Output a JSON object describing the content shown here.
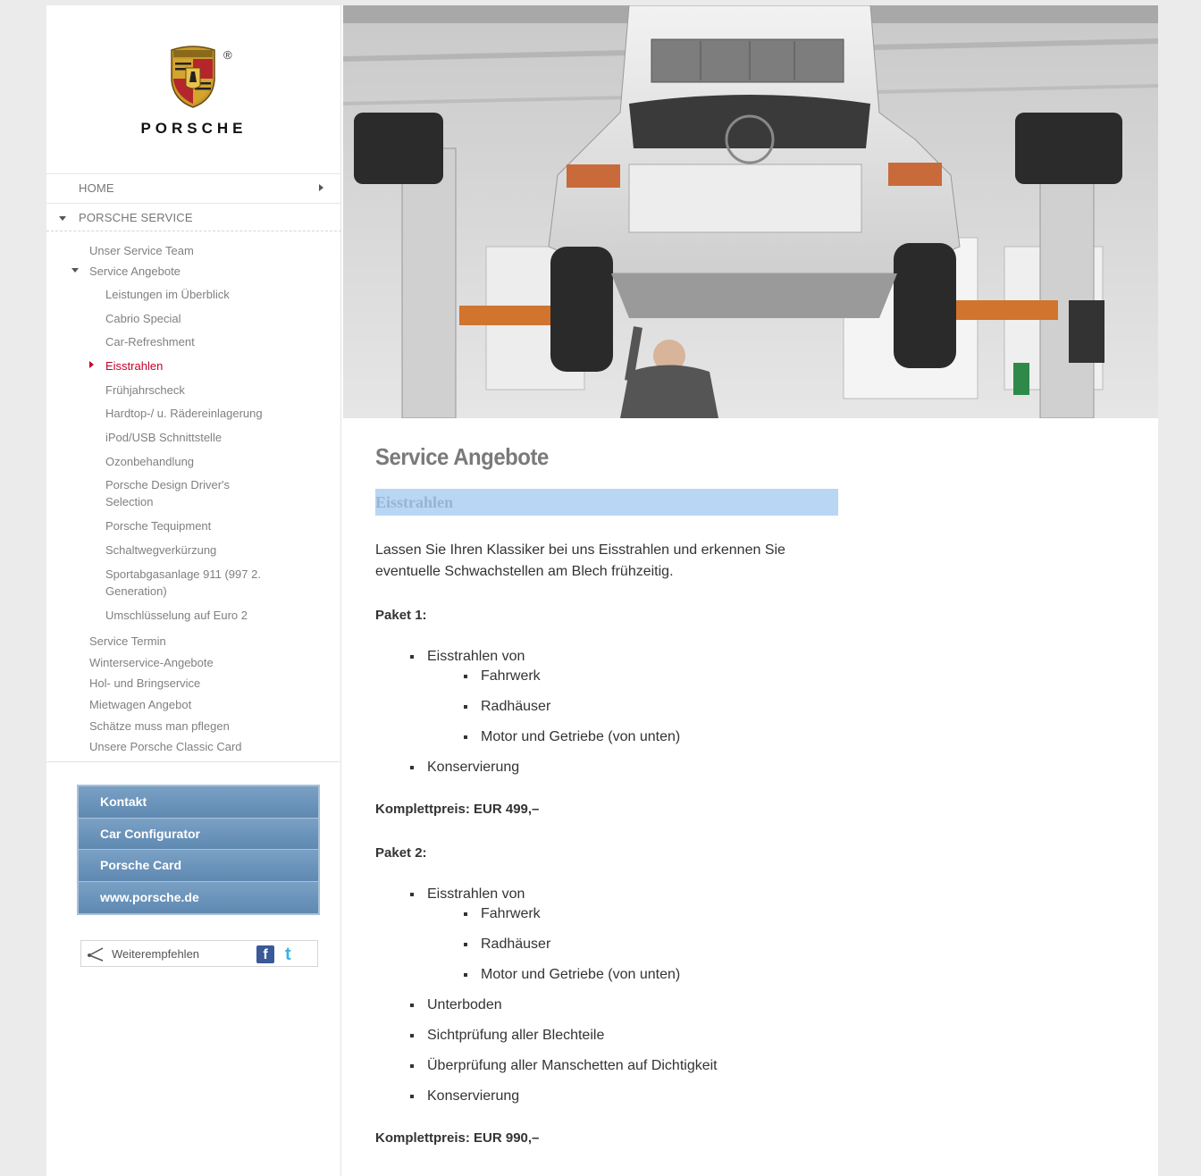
{
  "brand": {
    "name": "PORSCHE",
    "registered": "®"
  },
  "nav": {
    "home": "HOME",
    "service": "PORSCHE SERVICE",
    "items": [
      {
        "label": "Unser Service Team"
      },
      {
        "label": "Service Angebote"
      },
      {
        "label": "Leistungen im Überblick"
      },
      {
        "label": "Cabrio Special"
      },
      {
        "label": "Car-Refreshment"
      },
      {
        "label": "Eisstrahlen"
      },
      {
        "label": "Frühjahrscheck"
      },
      {
        "label": "Hardtop-/ u. Rädereinlagerung"
      },
      {
        "label": "iPod/USB Schnittstelle"
      },
      {
        "label": "Ozonbehandlung"
      },
      {
        "label": "Porsche Design Driver's Selection"
      },
      {
        "label": "Porsche Tequipment"
      },
      {
        "label": "Schaltwegverkürzung"
      },
      {
        "label": "Sportabgasanlage 911 (997 2. Generation)"
      },
      {
        "label": "Umschlüsselung auf Euro 2"
      },
      {
        "label": "Service Termin"
      },
      {
        "label": "Winterservice-Angebote"
      },
      {
        "label": "Hol- und Bringservice"
      },
      {
        "label": "Mietwagen Angebot"
      },
      {
        "label": "Schätze muss man pflegen"
      },
      {
        "label": "Unsere Porsche Classic Card"
      }
    ]
  },
  "quicklinks": [
    "Kontakt",
    "Car Configurator",
    "Porsche Card",
    "www.porsche.de"
  ],
  "share": {
    "label": "Weiterempfehlen",
    "facebook": "f",
    "twitter": "t"
  },
  "content": {
    "title": "Service Angebote",
    "subtitle": "Eisstrahlen",
    "intro": "Lassen Sie Ihren Klassiker bei uns Eisstrahlen und erkennen Sie eventuelle Schwachstellen am Blech frühzeitig.",
    "package1": {
      "title": "Paket 1:",
      "item1": "Eisstrahlen von",
      "sub": [
        "Fahrwerk",
        "Radhäuser",
        "Motor und Getriebe (von unten)"
      ],
      "item2": "Konservierung",
      "price": "Komplettpreis: EUR 499,–"
    },
    "package2": {
      "title": "Paket 2:",
      "item1": "Eisstrahlen von",
      "sub": [
        "Fahrwerk",
        "Radhäuser",
        "Motor und Getriebe (von unten)"
      ],
      "items": [
        "Unterboden",
        "Sichtprüfung aller Blechteile",
        "Überprüfung aller Manschetten auf Dichtigkeit",
        "Konservierung"
      ],
      "price": "Komplettpreis: EUR 990,–"
    }
  },
  "colors": {
    "accent": "#c4002d",
    "quicklinks_bg": "#6f95bb",
    "subtitle_bg": "#b9d6f5"
  },
  "icons": {
    "logo": "porsche-crest-icon",
    "share": "share-icon",
    "facebook": "facebook-icon",
    "twitter": "twitter-icon"
  }
}
